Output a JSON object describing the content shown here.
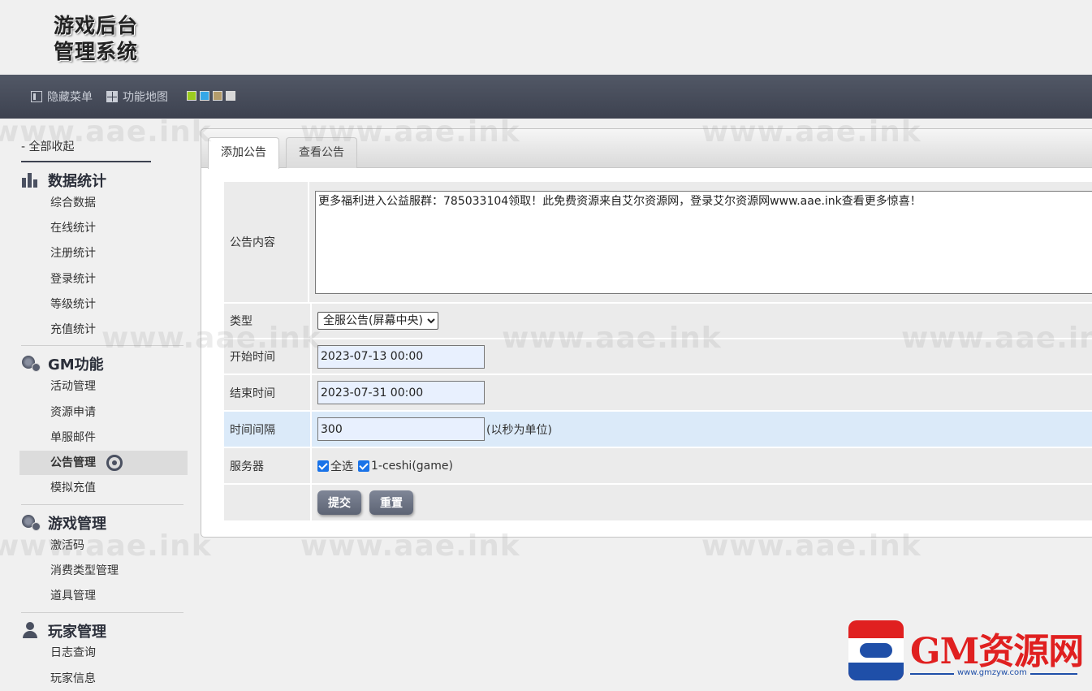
{
  "header": {
    "logo_line1": "游戏后台",
    "logo_line2": "管理系统"
  },
  "toolbar": {
    "hide_menu": "隐藏菜单",
    "function_map": "功能地图",
    "skins": [
      "#9ccc1f",
      "#35a7e8",
      "#b39c6b",
      "#d8d8d8"
    ]
  },
  "watermark": "www.aae.ink",
  "sidebar": {
    "collapse_all": "- 全部收起",
    "groups": [
      {
        "title": "数据统计",
        "icon": "bar-chart-icon",
        "items": [
          "综合数据",
          "在线统计",
          "注册统计",
          "登录统计",
          "等级统计",
          "充值统计"
        ]
      },
      {
        "title": "GM功能",
        "icon": "gear-icon",
        "items": [
          "活动管理",
          "资源申请",
          "单服邮件",
          "公告管理",
          "模拟充值"
        ]
      },
      {
        "title": "游戏管理",
        "icon": "gear-icon",
        "items": [
          "激活码",
          "消费类型管理",
          "道具管理"
        ]
      },
      {
        "title": "玩家管理",
        "icon": "user-icon",
        "items": [
          "日志查询",
          "玩家信息"
        ]
      }
    ],
    "active_item": "公告管理"
  },
  "tabs": [
    "添加公告",
    "查看公告"
  ],
  "form": {
    "content_label": "公告内容",
    "content_value": "更多福利进入公益服群：785033104领取！此免费资源来自艾尔资源网，登录艾尔资源网www.aae.ink查看更多惊喜！",
    "type_label": "类型",
    "type_selected": "全服公告(屏幕中央)",
    "start_label": "开始时间",
    "start_value": "2023-07-13 00:00",
    "end_label": "结束时间",
    "end_value": "2023-07-31 00:00",
    "interval_label": "时间间隔",
    "interval_value": "300",
    "interval_hint": "(以秒为单位)",
    "server_label": "服务器",
    "select_all": "全选",
    "server_option": "1-ceshi(game)",
    "submit": "提交",
    "reset": "重置"
  },
  "brand": {
    "name": "GM资源网",
    "url": "www.gmzyw.com",
    "color": "#e02020",
    "accent": "#1f4fa8"
  }
}
